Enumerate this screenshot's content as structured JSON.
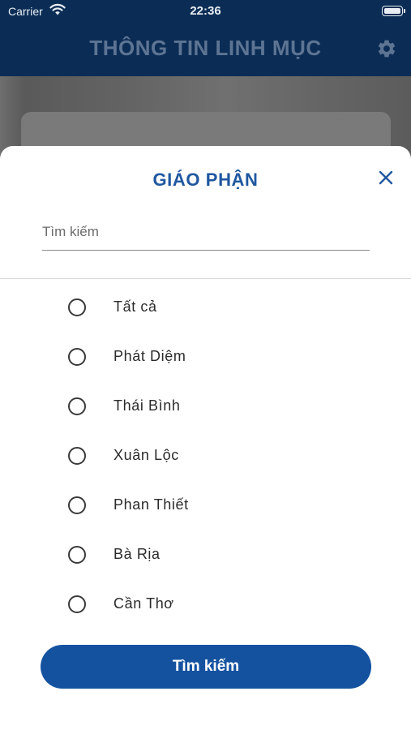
{
  "status_bar": {
    "carrier": "Carrier",
    "time": "22:36",
    "wifi_icon": "wifi-icon",
    "battery_icon": "battery-icon"
  },
  "nav_bar": {
    "title": "THÔNG TIN LINH MỤC",
    "settings_icon": "gear-icon",
    "background_color": "#0b2d55"
  },
  "sheet": {
    "title": "GIÁO PHẬN",
    "close_icon": "close-icon",
    "search": {
      "placeholder": "Tìm kiếm",
      "value": ""
    },
    "options": [
      {
        "label": "Tất cả",
        "selected": false
      },
      {
        "label": "Phát Diệm",
        "selected": false
      },
      {
        "label": "Thái Bình",
        "selected": false
      },
      {
        "label": "Xuân Lộc",
        "selected": false
      },
      {
        "label": "Phan Thiết",
        "selected": false
      },
      {
        "label": "Bà Rịa",
        "selected": false
      },
      {
        "label": "Cần Thơ",
        "selected": false
      }
    ],
    "submit_label": "Tìm kiếm",
    "accent_color": "#1452a0"
  }
}
